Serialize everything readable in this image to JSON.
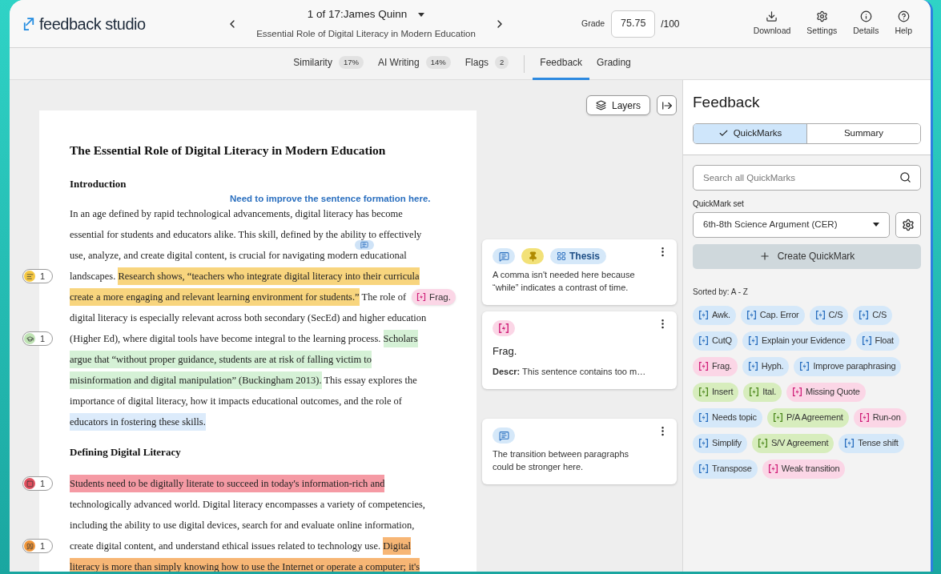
{
  "header": {
    "logo_text": "feedback studio",
    "submission": "1 of 17:James Quinn",
    "paper_title": "Essential Role of Digital Literacy in Modern Education",
    "grade_label": "Grade",
    "grade_value": "75.75",
    "grade_max": "/100",
    "actions": [
      {
        "kind": "download",
        "label": "Download"
      },
      {
        "kind": "settings",
        "label": "Settings"
      },
      {
        "kind": "details",
        "label": "Details"
      },
      {
        "kind": "help",
        "label": "Help"
      }
    ]
  },
  "tabs": [
    {
      "kind": "report",
      "label": "Similarity",
      "badge": "17%",
      "selected": false
    },
    {
      "kind": "report",
      "label": "AI Writing",
      "badge": "14%",
      "selected": false
    },
    {
      "kind": "report",
      "label": "Flags",
      "badge": "2",
      "selected": false
    },
    {
      "kind": "view",
      "label": "Feedback",
      "selected": true
    },
    {
      "kind": "view",
      "label": "Grading",
      "selected": false
    }
  ],
  "layers_button": "Layers",
  "document": {
    "title": "The Essential Role of Digital Literacy in Modern Education",
    "blocks": [
      {
        "kind": "heading",
        "text": "Introduction"
      },
      {
        "kind": "note",
        "text": "Need to improve the sentence formation here."
      },
      {
        "kind": "line",
        "segments": [
          {
            "text": "In an age defined by rapid technological advancements, digital literacy has become"
          }
        ]
      },
      {
        "kind": "line",
        "comment_pin": true,
        "segments": [
          {
            "text": "essential for students and educators alike. This skill, defined by the ability to effectively"
          }
        ]
      },
      {
        "kind": "line",
        "segments": [
          {
            "text": "use, analyze, and create digital content, is crucial for navigating modern educational"
          }
        ]
      },
      {
        "kind": "line",
        "marker": {
          "kind": "comment",
          "count": "1"
        },
        "segments": [
          {
            "text": "landscapes. "
          },
          {
            "text": "Research shows, “teachers who integrate digital literacy into their curricula",
            "color": "#f8d57e"
          }
        ]
      },
      {
        "kind": "line",
        "tag": {
          "label": "Frag.",
          "color": "#d0217a"
        },
        "segments": [
          {
            "text": "create a more engaging and relevant learning environment for students.”",
            "color": "#f8d57e"
          },
          {
            "text": " The role of"
          }
        ]
      },
      {
        "kind": "line",
        "segments": [
          {
            "text": "digital literacy is especially relevant across both secondary (SecEd) and higher education"
          }
        ]
      },
      {
        "kind": "line",
        "marker": {
          "kind": "rubric",
          "count": "1"
        },
        "segments": [
          {
            "text": "(Higher Ed), where digital tools have become integral to the learning process. "
          },
          {
            "text": "Scholars",
            "color": "#d5f1d6"
          }
        ]
      },
      {
        "kind": "line",
        "segments": [
          {
            "text": "argue that “without proper guidance, students are at risk of falling victim to",
            "color": "#d5f1d6"
          }
        ]
      },
      {
        "kind": "line",
        "segments": [
          {
            "text": "misinformation and digital manipulation” (Buckingham 2013).",
            "color": "#d5f1d6"
          },
          {
            "text": " This essay explores the"
          }
        ]
      },
      {
        "kind": "line",
        "segments": [
          {
            "text": "importance of digital literacy, how it impacts educational outcomes, and the role of"
          }
        ]
      },
      {
        "kind": "line",
        "segments": [
          {
            "text": "educators in fostering these skills.",
            "color": "#dcebfb"
          }
        ]
      },
      {
        "kind": "heading",
        "text": "Defining Digital Literacy"
      },
      {
        "kind": "line",
        "marker": {
          "kind": "flag",
          "count": "1"
        },
        "segments": [
          {
            "text": "Students need to be digitally literate to succeed in today's information-rich and",
            "color": "#f59aa4"
          }
        ]
      },
      {
        "kind": "line",
        "segments": [
          {
            "text": "technologically advanced world. Digital literacy encompasses a variety of competencies,"
          }
        ]
      },
      {
        "kind": "line",
        "segments": [
          {
            "text": "including the ability to use digital devices, search for and evaluate online information,"
          }
        ]
      },
      {
        "kind": "line",
        "marker": {
          "kind": "quote",
          "count": "1"
        },
        "segments": [
          {
            "text": "create digital content, and understand ethical issues related to technology use. "
          },
          {
            "text": "Digital",
            "color": "#f7b675"
          }
        ]
      },
      {
        "kind": "line",
        "segments": [
          {
            "text": "literacy is more than simply knowing how to use the Internet or operate a computer; it's",
            "color": "#f7b675"
          }
        ]
      }
    ]
  },
  "cards": [
    {
      "chips": [
        {
          "kind": "comment"
        },
        {
          "kind": "pin"
        },
        {
          "kind": "rubric",
          "label": "Thesis"
        }
      ],
      "text": "A comma isn't needed here because “while” indicates a contrast of time."
    },
    {
      "chips": [
        {
          "kind": "quickmark"
        }
      ],
      "title": "Frag.",
      "description_label": "Descr:",
      "description": "This sentence contains too m…"
    },
    {
      "chips": [
        {
          "kind": "comment"
        }
      ],
      "text": "The transition between paragraphs could be stronger here."
    }
  ],
  "feedback": {
    "title": "Feedback",
    "segments": [
      {
        "label": "QuickMarks",
        "selected": true
      },
      {
        "label": "Summary",
        "selected": false
      }
    ],
    "search_placeholder": "Search all QuickMarks",
    "set_label": "QuickMark set",
    "set_value": "6th-8th Science Argument (CER)",
    "create_button": "Create QuickMark",
    "sorted": "Sorted by: A - Z",
    "quickmarks": [
      {
        "label": "Awk.",
        "color": "#2a6fbf"
      },
      {
        "label": "Cap. Error",
        "color": "#2a6fbf"
      },
      {
        "label": "C/S",
        "color": "#2a6fbf"
      },
      {
        "label": "C/S",
        "color": "#2a6fbf"
      },
      {
        "label": "CutQ",
        "color": "#2a6fbf"
      },
      {
        "label": "Explain your Evidence",
        "color": "#2a6fbf"
      },
      {
        "label": "Float",
        "color": "#2a6fbf"
      },
      {
        "label": "Frag.",
        "color": "#d0217a"
      },
      {
        "label": "Hyph.",
        "color": "#2a6fbf"
      },
      {
        "label": "Improve paraphrasing",
        "color": "#2a6fbf"
      },
      {
        "label": "Insert",
        "color": "#4f8a1f"
      },
      {
        "label": "Ital.",
        "color": "#4f8a1f"
      },
      {
        "label": "Missing Quote",
        "color": "#d0217a"
      },
      {
        "label": "Needs topic",
        "color": "#2a6fbf"
      },
      {
        "label": "P/A Agreement",
        "color": "#4f8a1f"
      },
      {
        "label": "Run-on",
        "color": "#d0217a"
      },
      {
        "label": "Simplify",
        "color": "#2a6fbf"
      },
      {
        "label": "S/V Agreement",
        "color": "#4f8a1f"
      },
      {
        "label": "Tense shift",
        "color": "#2a6fbf"
      },
      {
        "label": "Transpose",
        "color": "#2a6fbf"
      },
      {
        "label": "Weak transition",
        "color": "#d0217a"
      }
    ]
  }
}
